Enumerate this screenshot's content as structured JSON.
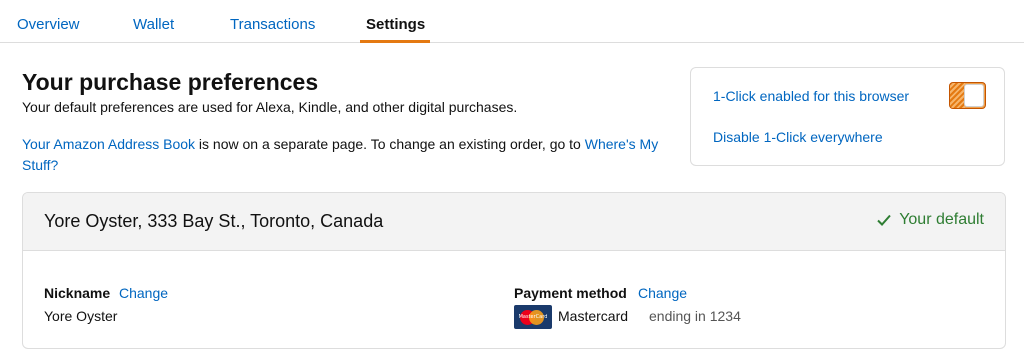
{
  "tabs": [
    {
      "label": "Overview"
    },
    {
      "label": "Wallet"
    },
    {
      "label": "Transactions"
    },
    {
      "label": "Settings",
      "active": true
    }
  ],
  "preferences": {
    "title": "Your purchase preferences",
    "subtitle": "Your default preferences are used for Alexa, Kindle, and other digital purchases.",
    "note_link_address_book": "Your Amazon Address Book",
    "note_text": " is now on a separate page. To change an existing order, go to ",
    "note_link_wheres_my_stuff": "Where's My Stuff?"
  },
  "one_click": {
    "status_label": "1-Click enabled for this browser",
    "disable_label": "Disable 1-Click everywhere",
    "toggle_on": true,
    "toggle_color": "#e47911"
  },
  "address_card": {
    "address": "Yore Oyster, 333 Bay St., Toronto, Canada",
    "default_label": "Your default",
    "default_color": "#2e7d32",
    "nickname_label": "Nickname",
    "nickname_change": "Change",
    "nickname_value": "Yore Oyster",
    "payment_label": "Payment method",
    "payment_change": "Change",
    "payment_brand": "Mastercard",
    "payment_ending": "ending in 1234",
    "card_icon": "mastercard-icon"
  },
  "colors": {
    "link": "#0066c0",
    "active_tab_underline": "#e47911"
  }
}
